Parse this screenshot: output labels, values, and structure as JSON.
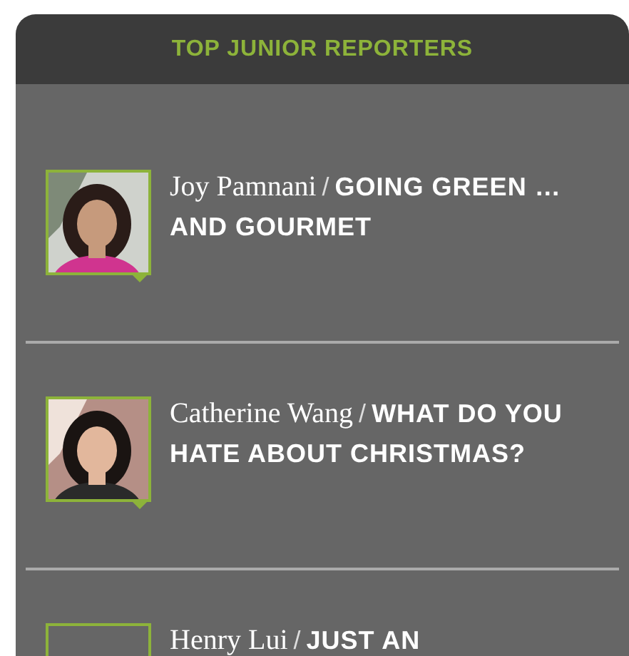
{
  "header": {
    "title": "TOP JUNIOR REPORTERS"
  },
  "reporters": [
    {
      "name": "Joy Pamnani",
      "separator": "/",
      "headline": "GOING GREEN … AND GOURMET"
    },
    {
      "name": "Catherine Wang",
      "separator": "/",
      "headline": "WHAT DO YOU HATE ABOUT CHRISTMAS?"
    },
    {
      "name": "Henry Lui",
      "separator": "/",
      "headline": "JUST AN",
      "avatar": {
        "kind": "empty"
      }
    }
  ]
}
